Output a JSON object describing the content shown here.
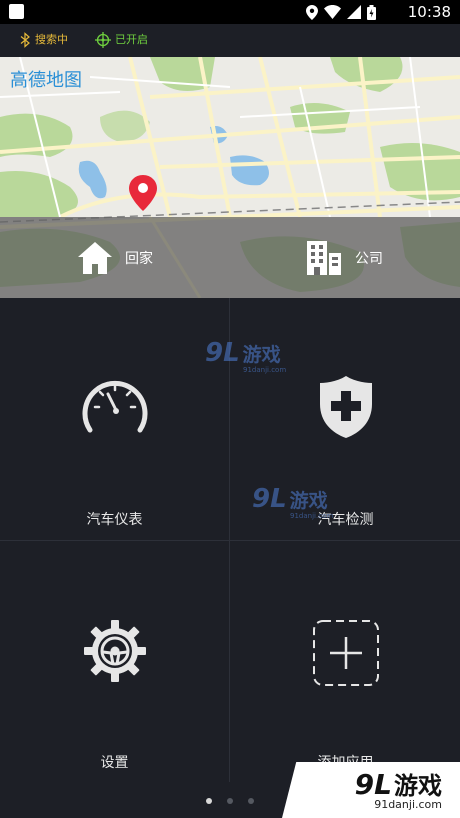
{
  "status_bar": {
    "time": "10:38",
    "icons": [
      "location-icon",
      "wifi-icon",
      "signal-icon",
      "battery-icon"
    ]
  },
  "app_bar": {
    "bluetooth_status": "搜索中",
    "gps_status": "已开启",
    "colors": {
      "bluetooth": "#e5b93a",
      "gps": "#6fcf3f"
    }
  },
  "map": {
    "title": "高德地图",
    "shortcuts": {
      "home": "回家",
      "company": "公司"
    }
  },
  "grid": {
    "items": [
      {
        "label": "汽车仪表",
        "icon": "speedometer-icon"
      },
      {
        "label": "汽车检测",
        "icon": "shield-plus-icon"
      },
      {
        "label": "设置",
        "icon": "steering-gear-icon"
      },
      {
        "label": "添加应用",
        "icon": "add-icon"
      }
    ]
  },
  "pager": {
    "pages": 3,
    "active": 1
  },
  "watermark": {
    "number": "9L",
    "text": "游戏",
    "sub": "91danji.com"
  },
  "corner_logo": {
    "number": "9L",
    "text": "游戏",
    "sub": "91danji.com"
  }
}
